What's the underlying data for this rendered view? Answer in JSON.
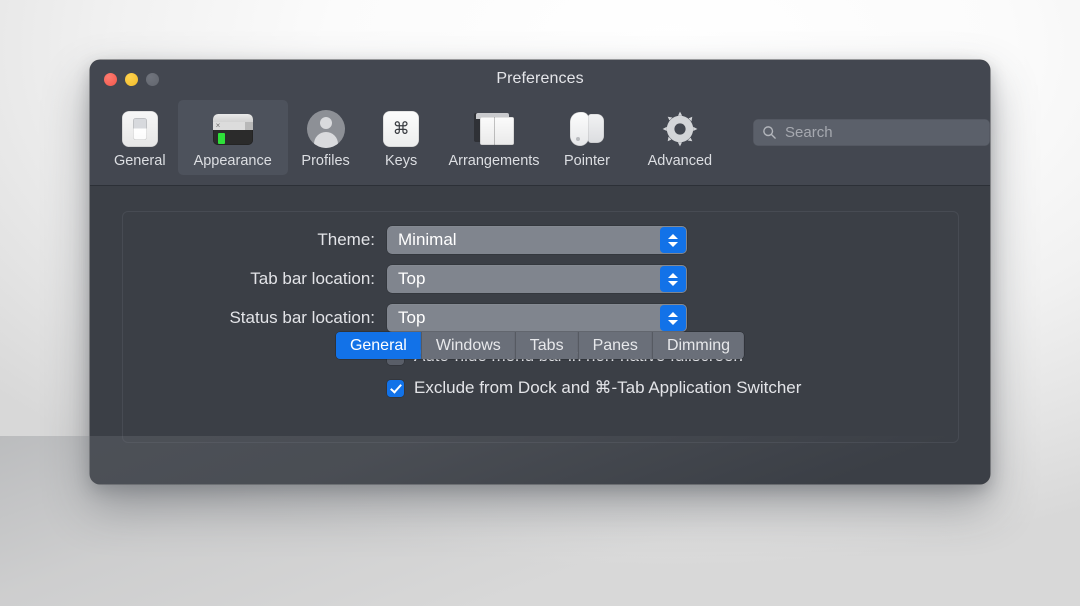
{
  "window": {
    "title": "Preferences",
    "traffic_lights": [
      {
        "name": "close",
        "color": "#f1584c"
      },
      {
        "name": "minimize",
        "color": "#f0bc2c"
      },
      {
        "name": "zoom",
        "color": "#62666e"
      }
    ]
  },
  "toolbar": {
    "items": [
      {
        "label": "General",
        "icon": "general-icon",
        "selected": false
      },
      {
        "label": "Appearance",
        "icon": "appearance-icon",
        "selected": true
      },
      {
        "label": "Profiles",
        "icon": "profiles-icon",
        "selected": false
      },
      {
        "label": "Keys",
        "icon": "keys-icon",
        "selected": false
      },
      {
        "label": "Arrangements",
        "icon": "arrangements-icon",
        "selected": false
      },
      {
        "label": "Pointer",
        "icon": "pointer-icon",
        "selected": false
      },
      {
        "label": "Advanced",
        "icon": "advanced-gear-icon",
        "selected": false
      }
    ],
    "keys_glyph": "⌘",
    "search": {
      "placeholder": "Search",
      "value": "",
      "icon": "search-icon"
    }
  },
  "tabs": {
    "items": [
      {
        "label": "General",
        "active": true
      },
      {
        "label": "Windows",
        "active": false
      },
      {
        "label": "Tabs",
        "active": false
      },
      {
        "label": "Panes",
        "active": false
      },
      {
        "label": "Dimming",
        "active": false
      }
    ]
  },
  "form": {
    "rows": [
      {
        "label": "Theme:",
        "value": "Minimal"
      },
      {
        "label": "Tab bar location:",
        "value": "Top"
      },
      {
        "label": "Status bar location:",
        "value": "Top"
      }
    ],
    "checkboxes": [
      {
        "label": "Auto-hide menu bar in non-native fullscreen",
        "checked": false
      },
      {
        "label": "Exclude from Dock and ⌘-Tab Application Switcher",
        "checked": true
      }
    ]
  },
  "annotation": {
    "highlight_color": "#fa2016",
    "target": "Exclude from Dock and ⌘-Tab Application Switcher"
  },
  "colors": {
    "accent": "#1272e8",
    "window_bg": "#3b3f46",
    "toolbar_bg": "#434750",
    "popup_bg": "#80858e",
    "segment_bg": "#6a6f79"
  }
}
